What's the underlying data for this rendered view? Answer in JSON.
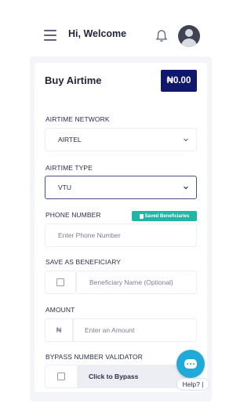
{
  "header": {
    "greeting": "Hi, Welcome"
  },
  "card": {
    "title": "Buy Airtime",
    "balance": "₦0.00"
  },
  "form": {
    "network": {
      "label": "AIRTIME NETWORK",
      "value": "AIRTEL"
    },
    "type": {
      "label": "AIRTIME TYPE",
      "value": "VTU"
    },
    "phone": {
      "label": "PHONE NUMBER",
      "placeholder": "Enter Phone Number",
      "saved_button": "Saved Beneficiaries"
    },
    "beneficiary": {
      "label": "SAVE AS BENEFICIARY",
      "placeholder": "Beneficiary Name (Optional)"
    },
    "amount": {
      "label": "AMOUNT",
      "prefix": "₦",
      "placeholder": "Enter an Amount"
    },
    "bypass": {
      "label": "BYPASS NUMBER VALIDATOR",
      "button": "Click to Bypass"
    }
  },
  "help": {
    "label": "Help? |"
  },
  "colors": {
    "primary": "#10186b",
    "accent": "#1fb6a6",
    "chat": "#1faad8"
  },
  "icons": [
    "menu-icon",
    "bell-icon",
    "avatar-icon",
    "chevron-down-icon",
    "chat-icon"
  ]
}
